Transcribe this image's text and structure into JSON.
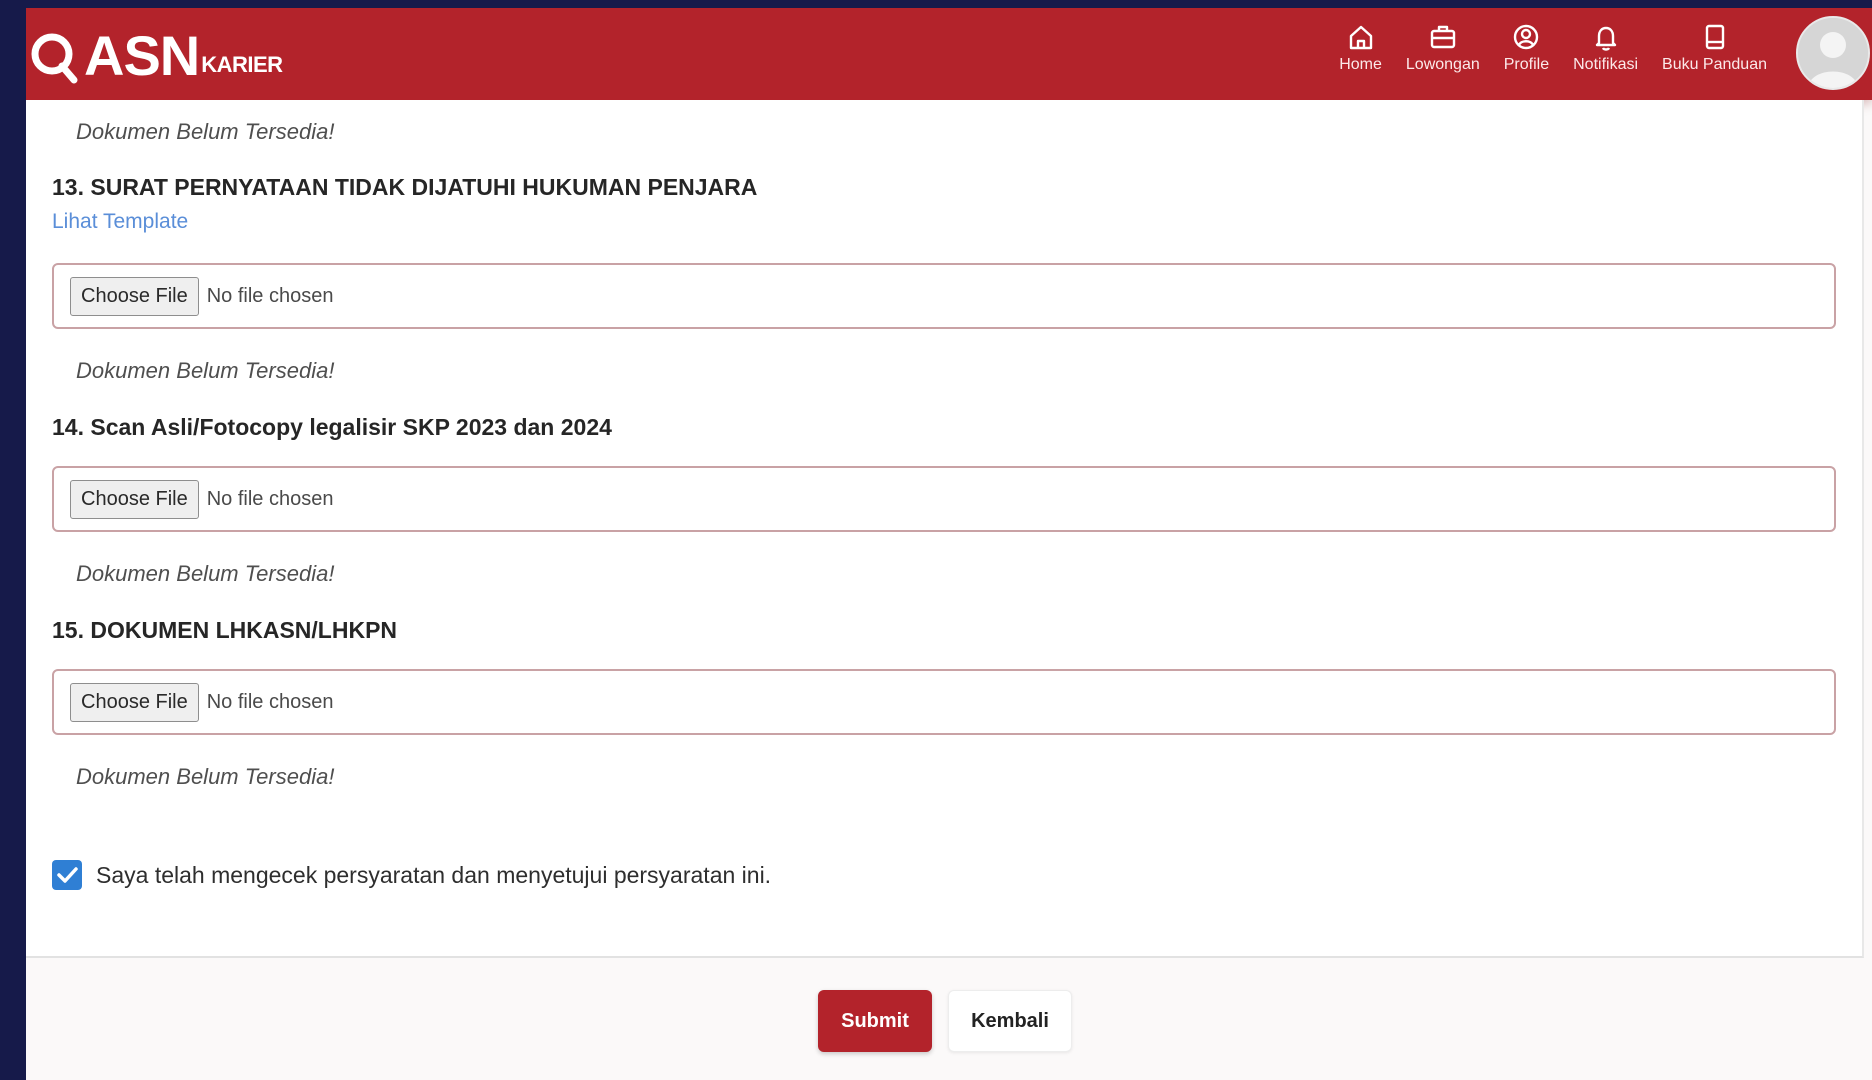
{
  "brand": {
    "name": "ASN",
    "suffix": "KARIER"
  },
  "nav": {
    "items": [
      {
        "label": "Home",
        "icon": "home-icon"
      },
      {
        "label": "Lowongan",
        "icon": "briefcase-icon"
      },
      {
        "label": "Profile",
        "icon": "profile-icon"
      },
      {
        "label": "Notifikasi",
        "icon": "bell-icon"
      },
      {
        "label": "Buku Panduan",
        "icon": "book-icon"
      }
    ],
    "avatar_icon": "user-avatar-icon"
  },
  "form": {
    "prev_status": "Dokumen Belum Tersedia!",
    "fields": [
      {
        "title": "13. SURAT PERNYATAAN TIDAK DIJATUHI HUKUMAN PENJARA",
        "template_link": "Lihat Template",
        "button": "Choose File",
        "file_text": "No file chosen",
        "status": "Dokumen Belum Tersedia!"
      },
      {
        "title": "14. Scan Asli/Fotocopy legalisir SKP 2023 dan 2024",
        "button": "Choose File",
        "file_text": "No file chosen",
        "status": "Dokumen Belum Tersedia!"
      },
      {
        "title": "15. DOKUMEN LHKASN/LHKPN",
        "button": "Choose File",
        "file_text": "No file chosen",
        "status": "Dokumen Belum Tersedia!"
      }
    ],
    "agreement": {
      "checked": true,
      "text": "Saya telah mengecek persyaratan dan menyetujui persyaratan ini."
    }
  },
  "actions": {
    "submit": "Submit",
    "back": "Kembali"
  },
  "colors": {
    "brand_red": "#b3232b",
    "link_blue": "#5a8ed8",
    "checkbox_blue": "#2f7fd4"
  }
}
